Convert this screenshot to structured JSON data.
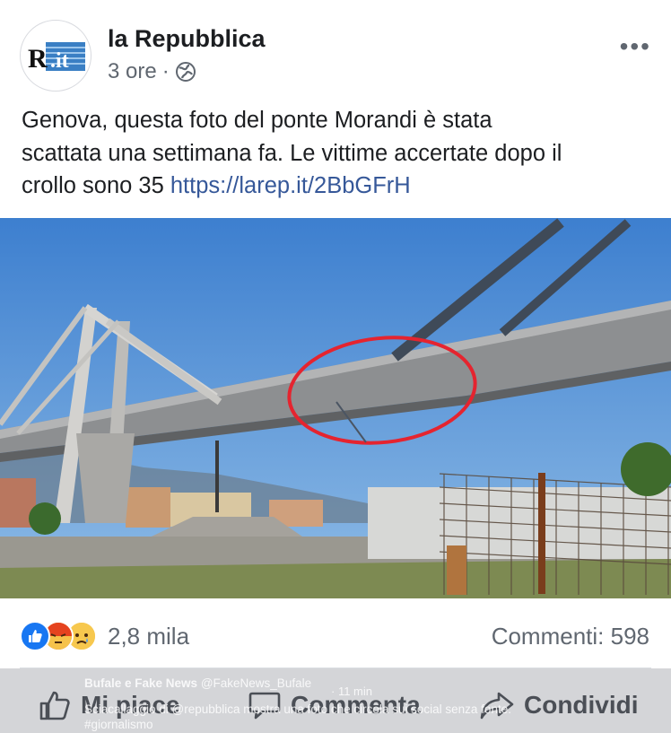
{
  "post": {
    "page_name": "la Repubblica",
    "avatar_logo_text": "R.it",
    "time": "3 ore",
    "separator": "·",
    "text_line1": "Genova, questa foto del ponte Morandi è stata",
    "text_line2": "scattata una settimana fa. Le vittime accertate dopo il",
    "text_line3": "crollo sono 35",
    "link": "https://larep.it/2BbGFrH",
    "more_label": "•••"
  },
  "stats": {
    "reactions": [
      "like",
      "angry",
      "sad"
    ],
    "reaction_count": "2,8 mila",
    "comments": "Commenti: 598"
  },
  "actions": {
    "like": "Mi piace",
    "comment": "Commenta",
    "share": "Condividi"
  },
  "overlay_tweet": {
    "name": "Bufale e Fake News",
    "handle": "@FakeNews_Bufale",
    "time": "· 11 min",
    "line1": "Sciacallaggio di @repubblica mostra una foto che circola sui social senza fonte.",
    "line2": "#giornalismo"
  },
  "colors": {
    "link": "#365899",
    "meta": "#606770",
    "sky": "#4f8fd6",
    "highlight_circle": "#e5242f",
    "like_blue": "#1877f2"
  }
}
